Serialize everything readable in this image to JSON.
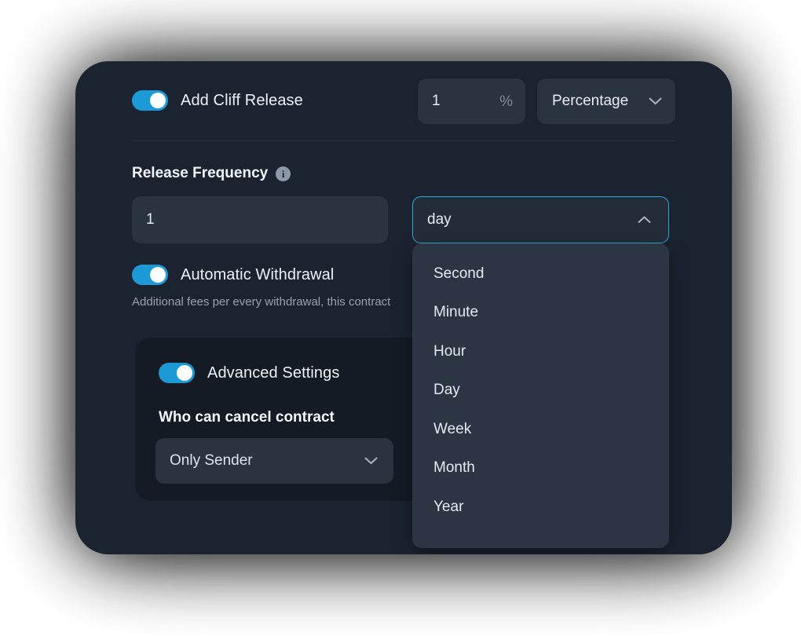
{
  "cliff": {
    "toggle_label": "Add Cliff Release",
    "toggle_state": "on",
    "amount_value": "1",
    "percent_icon": "%",
    "unit_value": "Percentage",
    "unit_chevron": "chevron-down-icon"
  },
  "release_frequency": {
    "label": "Release Frequency",
    "info_icon": "i",
    "quantity_value": "1",
    "unit_value": "day",
    "unit_chevron": "chevron-up-icon",
    "options": [
      "Second",
      "Minute",
      "Hour",
      "Day",
      "Week",
      "Month",
      "Year"
    ]
  },
  "automatic_withdrawal": {
    "toggle_label": "Automatic Withdrawal",
    "toggle_state": "on",
    "help_text": "Additional fees per every withdrawal, this contract"
  },
  "advanced_settings": {
    "toggle_label": "Advanced Settings",
    "toggle_state": "on",
    "cancel_title": "Who can cancel contract",
    "cancel_value": "Only Sender",
    "cancel_chevron": "chevron-down-icon"
  },
  "colors": {
    "accent_toggle": "#1c9ad6",
    "focus_border": "#35a5d8",
    "panel_bg": "#1b2330",
    "card_bg": "#141b25",
    "field_bg": "#2a3340",
    "dropdown_bg": "#2b3544"
  }
}
